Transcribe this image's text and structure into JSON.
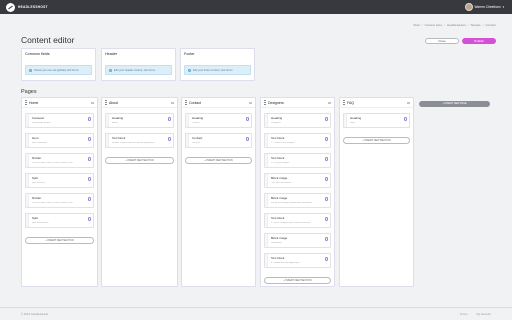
{
  "brand": {
    "name": "HEADLESSHOST"
  },
  "user": {
    "name": "Warren Cheetham",
    "caret": "▾"
  },
  "breadcrumb": [
    "Start",
    "Content sites",
    "HeadlessHost",
    "Sample",
    "Content"
  ],
  "page": {
    "title": "Content editor"
  },
  "actions": {
    "close": "Close",
    "publish": "Publish"
  },
  "colors": {
    "publish": "#d550d8",
    "topbar": "#37393f",
    "info": "#dceef8"
  },
  "common": [
    {
      "title": "Common fields",
      "info": "Shows you can use globally with forms"
    },
    {
      "title": "Header",
      "info": "Edit your header content, site forms"
    },
    {
      "title": "Footer",
      "info": "Edit your footer content, site forms"
    }
  ],
  "pages_label": "Pages",
  "columns": [
    {
      "name": "Home",
      "add": "+ INSERT NEW SECTION",
      "sections": [
        {
          "title": "Carousel",
          "sub": "Home page banner"
        },
        {
          "title": "Hero",
          "sub": "Hero statement"
        },
        {
          "title": "Divider",
          "sub": "Use this when 'Hero' is not as wide as this"
        },
        {
          "title": "Split",
          "sub": "Split services"
        },
        {
          "title": "Divider",
          "sub": "Use this when 'Hero' is not as wide as this"
        },
        {
          "title": "Split",
          "sub": "Split testimonials"
        }
      ]
    },
    {
      "name": "About",
      "add": "+ INSERT NEW SECTION",
      "sections": [
        {
          "title": "Heading",
          "sub": "About"
        },
        {
          "title": "Text block",
          "sub": "Header content from the service agreement"
        }
      ]
    },
    {
      "name": "Contact",
      "add": "+ INSERT NEW SECTION",
      "sections": [
        {
          "title": "Heading",
          "sub": "Contact"
        },
        {
          "title": "Contact",
          "sub": "Get info"
        }
      ]
    },
    {
      "name": "Designers",
      "add": "+ INSERT NEW SECTION",
      "sections": [
        {
          "title": "Heading",
          "sub": "Designers"
        },
        {
          "title": "Text block",
          "sub": "1. Create a new website"
        },
        {
          "title": "Text block",
          "sub": "2. Pick your layout"
        },
        {
          "title": "Block image",
          "sub": "Test your dashboard"
        },
        {
          "title": "Block image",
          "sub": "Set up an existing content with dashboard"
        },
        {
          "title": "Text block",
          "sub": "3. Set to configure your content structure"
        },
        {
          "title": "Block image",
          "sub": "Dashboard"
        },
        {
          "title": "Text block",
          "sub": "4. Submit the new app/project"
        }
      ]
    },
    {
      "name": "FAQ",
      "add": "+ INSERT NEW SECTION",
      "sections": [
        {
          "title": "Heading",
          "sub": "FAQs"
        }
      ]
    }
  ],
  "new_page": "+ INSERT NEW PAGE",
  "footer": {
    "copyright": "© 2019 HeadlessHost",
    "links": [
      "Terms",
      "My Account"
    ]
  }
}
